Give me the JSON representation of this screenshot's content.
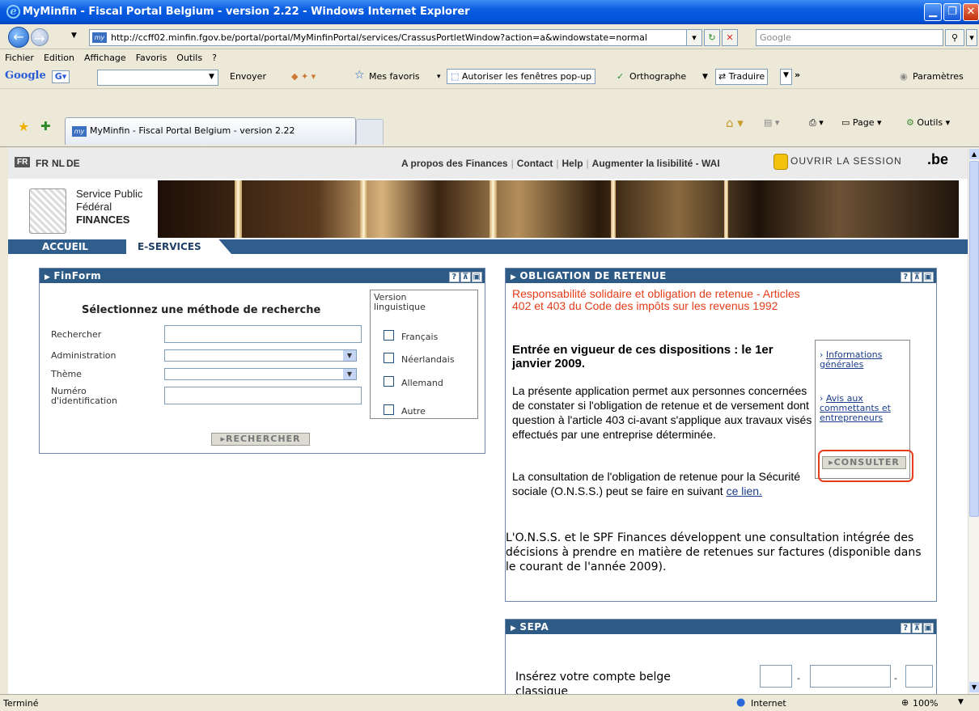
{
  "window": {
    "title": "MyMinfin - Fiscal Portal Belgium - version 2.22 - Windows Internet Explorer",
    "address": "http://ccff02.minfin.fgov.be/portal/portal/MyMinfinPortal/services/CrassusPortletWindow?action=a&windowstate=normal",
    "search_placeholder": "Google"
  },
  "menu": [
    "Fichier",
    "Edition",
    "Affichage",
    "Favoris",
    "Outils",
    "?"
  ],
  "gtoolbar": {
    "google": "Google",
    "send": "Envoyer",
    "favorites": "Mes favoris",
    "popup": "Autoriser les fenêtres pop-up",
    "spell": "Orthographe",
    "translate": "Traduire",
    "settings": "Paramètres"
  },
  "tab": {
    "label": "MyMinfin - Fiscal Portal Belgium - version 2.22"
  },
  "cmdbar": {
    "page": "Page",
    "tools": "Outils"
  },
  "page": {
    "langs": [
      "FR",
      "FR",
      "NL",
      "DE"
    ],
    "toplinks": [
      "A propos des Finances",
      "Contact",
      "Help",
      "Augmenter la lisibilité - WAI"
    ],
    "login": "OUVRIR LA SESSION",
    "be": ".be",
    "spf": [
      "Service Public",
      "Fédéral",
      "FINANCES"
    ],
    "nav": {
      "home": "ACCUEIL",
      "eservices": "E-SERVICES"
    }
  },
  "finform": {
    "title": "FinForm",
    "heading": "Sélectionnez une méthode de recherche",
    "labels": {
      "search": "Rechercher",
      "admin": "Administration",
      "theme": "Thème",
      "id": "Numéro d'identification"
    },
    "version_label": "Version linguistique",
    "languages": [
      "Français",
      "Néerlandais",
      "Allemand",
      "Autre"
    ],
    "button": "RECHERCHER"
  },
  "obligation": {
    "title": "OBLIGATION DE RETENUE",
    "red": "Responsabilité solidaire et obligation de retenue - Articles 402 et 403 du Code des impôts sur les revenus 1992",
    "bold": "Entrée en vigueur de ces dispositions : le 1er janvier 2009.",
    "p1": "La présente application permet aux personnes concernées de constater si l'obligation de retenue et de versement dont question à l'article 403 ci-avant s'applique aux travaux visés effectués par une entreprise déterminée.",
    "p2_pre": "La consultation de l'obligation de retenue pour la Sécurité sociale (O.N.S.S.) peut se faire en suivant ",
    "p2_link": "ce lien.",
    "p3": "L'O.N.S.S. et le SPF Finances développent une consultation intégrée des décisions à prendre en matière de retenues sur factures (disponible dans le courant de l'année 2009).",
    "side_links": [
      "Informations générales",
      "Avis aux commettants et entrepreneurs"
    ],
    "button": "CONSULTER"
  },
  "sepa": {
    "title": "SEPA",
    "text": "Insérez votre compte belge classique"
  },
  "status": {
    "left": "Terminé",
    "zone": "Internet",
    "zoom": "100%"
  },
  "colors": {
    "header_blue": "#2e5a86",
    "highlight": "#e43e1a"
  }
}
